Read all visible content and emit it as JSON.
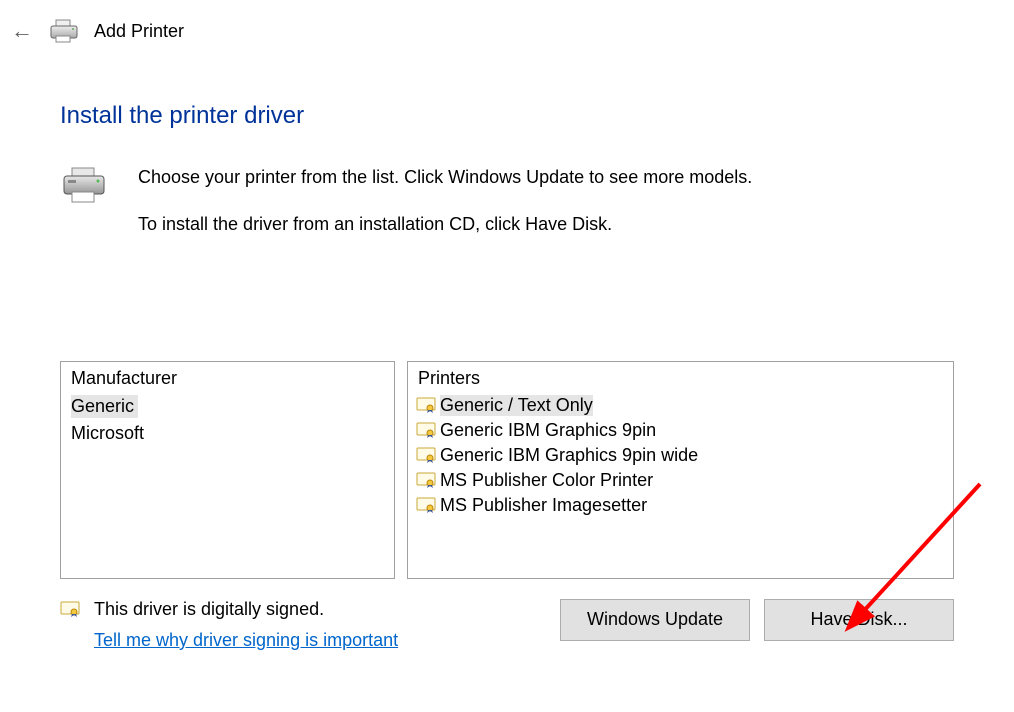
{
  "header": {
    "title": "Add Printer"
  },
  "heading": "Install the printer driver",
  "instructions": {
    "line1": "Choose your printer from the list. Click Windows Update to see more models.",
    "line2": "To install the driver from an installation CD, click Have Disk."
  },
  "panel_left": {
    "header": "Manufacturer",
    "items": [
      {
        "label": "Generic",
        "selected": true
      },
      {
        "label": "Microsoft",
        "selected": false
      }
    ]
  },
  "panel_right": {
    "header": "Printers",
    "items": [
      {
        "label": "Generic / Text Only",
        "selected": true
      },
      {
        "label": "Generic IBM Graphics 9pin",
        "selected": false
      },
      {
        "label": "Generic IBM Graphics 9pin wide",
        "selected": false
      },
      {
        "label": "MS Publisher Color Printer",
        "selected": false
      },
      {
        "label": "MS Publisher Imagesetter",
        "selected": false
      }
    ]
  },
  "signing": {
    "status": "This driver is digitally signed.",
    "link": "Tell me why driver signing is important"
  },
  "buttons": {
    "update": "Windows Update",
    "disk": "Have Disk..."
  }
}
